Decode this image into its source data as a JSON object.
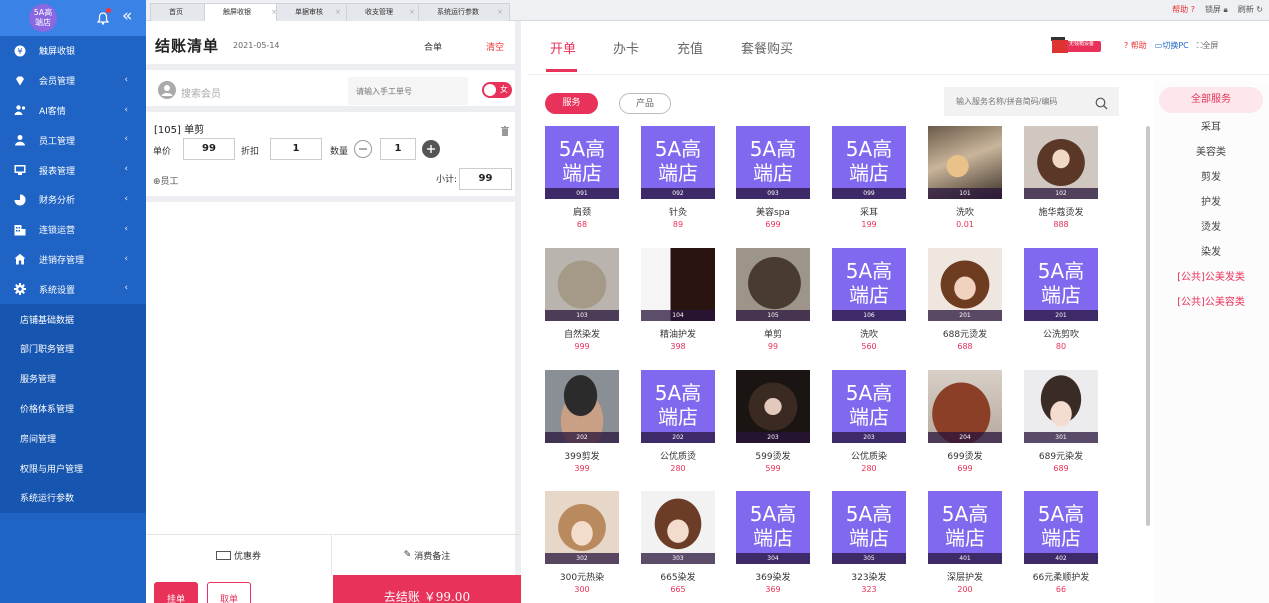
{
  "sidebar": {
    "logo_line1": "5A高",
    "logo_line2": "端店",
    "menu": [
      {
        "label": "触屏收银",
        "icon": "cash-register-icon",
        "chevron": false
      },
      {
        "label": "会员管理",
        "icon": "diamond-icon",
        "chevron": true
      },
      {
        "label": "AI客情",
        "icon": "ai-users-icon",
        "chevron": true
      },
      {
        "label": "员工管理",
        "icon": "user-icon",
        "chevron": true
      },
      {
        "label": "报表管理",
        "icon": "monitor-icon",
        "chevron": true
      },
      {
        "label": "财务分析",
        "icon": "pie-chart-icon",
        "chevron": true
      },
      {
        "label": "连锁运营",
        "icon": "building-icon",
        "chevron": true
      },
      {
        "label": "进销存管理",
        "icon": "house-icon",
        "chevron": true
      },
      {
        "label": "系统设置",
        "icon": "gear-icon",
        "chevron": true
      }
    ],
    "submenu": [
      "店铺基础数据",
      "部门职务管理",
      "服务管理",
      "价格体系管理",
      "房间管理",
      "权限与用户管理",
      "系统运行参数"
    ]
  },
  "tabbar": {
    "tabs": [
      "首页",
      "触屏收银",
      "单据审核",
      "收支管理",
      "系统运行参数"
    ],
    "help": "帮助",
    "lock": "锁屏",
    "refresh": "刷新"
  },
  "checkout": {
    "title": "结账清单",
    "date": "2021-05-14",
    "merge": "合单",
    "clear": "清空",
    "member_placeholder": "搜索会员",
    "manual_placeholder": "请输入手工单号",
    "gender": "女",
    "item": {
      "name": "[105] 单剪",
      "price_label": "单价",
      "price": "99",
      "discount_label": "折扣",
      "discount": "1",
      "qty_label": "数量",
      "qty": "1",
      "staff_label": "员工",
      "subtotal_label": "小计:",
      "subtotal": "99"
    },
    "coupon": "优惠券",
    "remark": "消费备注",
    "hold": "挂单",
    "take": "取单",
    "pay": "去结账 ￥99.00"
  },
  "main": {
    "tabs": [
      "开单",
      "办卡",
      "充值",
      "套餐购买"
    ],
    "cashbox_label": "无钱箱设备",
    "help": "帮助",
    "switch_pc": "切换PC",
    "fullscreen": "全屏",
    "filters": [
      "服务",
      "产品"
    ],
    "search_placeholder": "输入服务名称/拼音简码/编码"
  },
  "services": [
    {
      "code": "091",
      "name": "肩颈",
      "price": "68",
      "img": "placeholder"
    },
    {
      "code": "092",
      "name": "针灸",
      "price": "89",
      "img": "placeholder"
    },
    {
      "code": "093",
      "name": "美容spa",
      "price": "699",
      "img": "placeholder"
    },
    {
      "code": "099",
      "name": "采耳",
      "price": "199",
      "img": "placeholder"
    },
    {
      "code": "101",
      "name": "洗吹",
      "price": "0.01",
      "img": "wash"
    },
    {
      "code": "102",
      "name": "施华蔻烫发",
      "price": "888",
      "img": "curly-brown"
    },
    {
      "code": "103",
      "name": "自然染发",
      "price": "999",
      "img": "bob-ash"
    },
    {
      "code": "104",
      "name": "精油护发",
      "price": "398",
      "img": "oil-dark"
    },
    {
      "code": "105",
      "name": "单剪",
      "price": "99",
      "img": "bob-brown"
    },
    {
      "code": "106",
      "name": "洗吹",
      "price": "560",
      "img": "placeholder"
    },
    {
      "code": "201",
      "name": "688元烫发",
      "price": "688",
      "img": "woman-wave"
    },
    {
      "code": "201",
      "name": "公洗剪吹",
      "price": "80",
      "img": "placeholder"
    },
    {
      "code": "202",
      "name": "399剪发",
      "price": "399",
      "img": "man-fade"
    },
    {
      "code": "202",
      "name": "公优质烫",
      "price": "280",
      "img": "placeholder"
    },
    {
      "code": "203",
      "name": "599烫发",
      "price": "599",
      "img": "woman-dark"
    },
    {
      "code": "203",
      "name": "公优质染",
      "price": "280",
      "img": "placeholder"
    },
    {
      "code": "204",
      "name": "699烫发",
      "price": "699",
      "img": "hair-red"
    },
    {
      "code": "301",
      "name": "689元染发",
      "price": "689",
      "img": "woman-updo"
    },
    {
      "code": "302",
      "name": "300元热染",
      "price": "300",
      "img": "woman-light"
    },
    {
      "code": "303",
      "name": "665染发",
      "price": "665",
      "img": "woman-bob"
    },
    {
      "code": "304",
      "name": "369染发",
      "price": "369",
      "img": "placeholder"
    },
    {
      "code": "305",
      "name": "323染发",
      "price": "323",
      "img": "placeholder"
    },
    {
      "code": "401",
      "name": "深层护发",
      "price": "200",
      "img": "placeholder"
    },
    {
      "code": "402",
      "name": "66元柔顺护发",
      "price": "66",
      "img": "placeholder"
    }
  ],
  "placeholder_text": {
    "line1": "5A高",
    "line2": "端店"
  },
  "categories": [
    "全部服务",
    "采耳",
    "美容类",
    "剪发",
    "护发",
    "烫发",
    "染发",
    "[公共]公美发类",
    "[公共]公美容类"
  ],
  "colors": {
    "accent": "#e8325a",
    "sidebar": "#1f64c5",
    "placeholder": "#8168ee"
  }
}
